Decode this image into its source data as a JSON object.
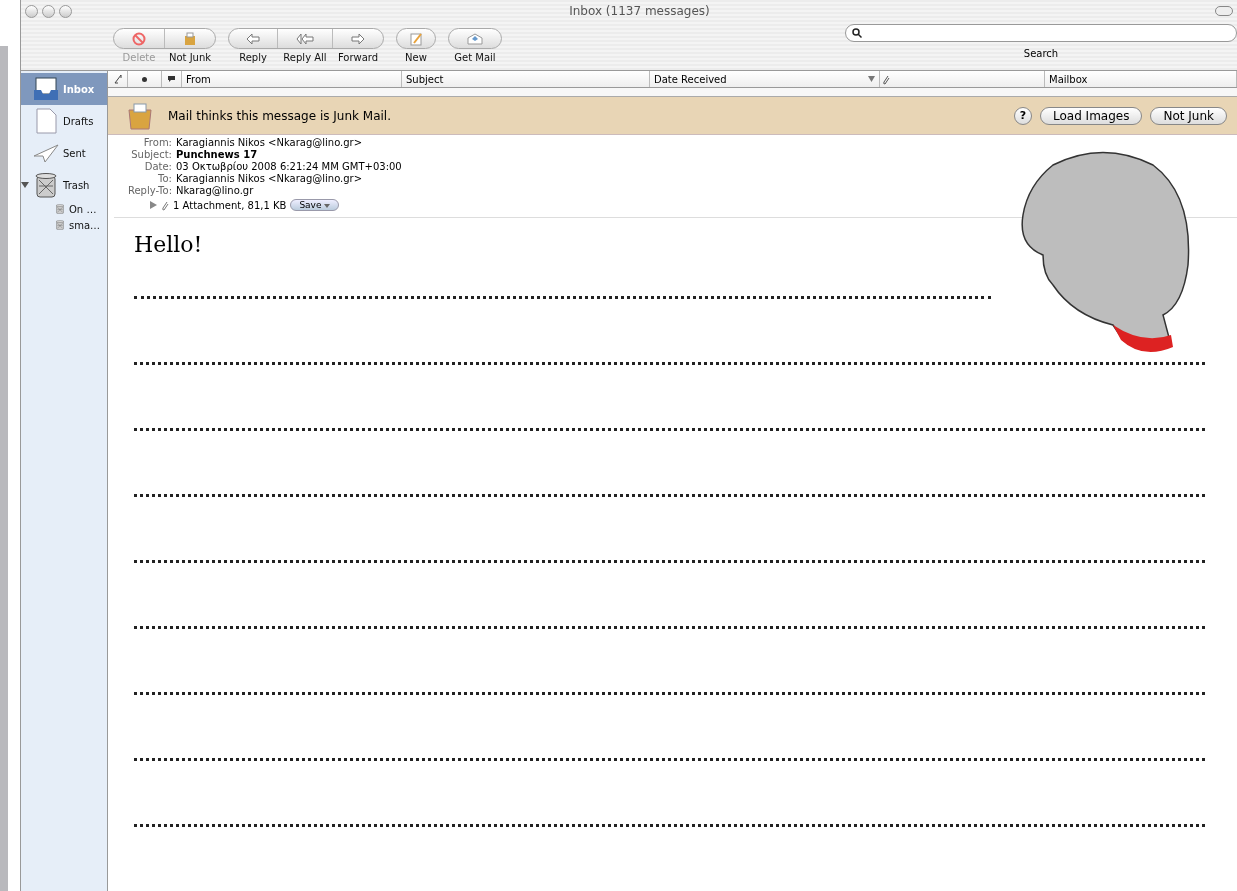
{
  "window": {
    "title": "Inbox (1137 messages)"
  },
  "toolbar": {
    "groups": [
      [
        {
          "label": "Delete",
          "kind": "delete",
          "disabled": true
        },
        {
          "label": "Not Junk",
          "kind": "junk",
          "disabled": false
        }
      ],
      [
        {
          "label": "Reply",
          "kind": "reply",
          "disabled": false
        },
        {
          "label": "Reply All",
          "kind": "replyall",
          "disabled": false
        },
        {
          "label": "Forward",
          "kind": "forward",
          "disabled": false
        }
      ],
      [
        {
          "label": "New",
          "kind": "new",
          "disabled": false
        }
      ],
      [
        {
          "label": "Get Mail",
          "kind": "getmail",
          "disabled": false
        }
      ]
    ],
    "search": {
      "label": "Search"
    }
  },
  "sidebar": {
    "items": [
      {
        "label": "Inbox",
        "kind": "inbox",
        "selected": true
      },
      {
        "label": "Drafts",
        "kind": "drafts",
        "selected": false
      },
      {
        "label": "Sent",
        "kind": "sent",
        "selected": false
      },
      {
        "label": "Trash",
        "kind": "trash",
        "selected": false,
        "expanded": true,
        "children": [
          {
            "label": "On …",
            "kind": "trash",
            "selected": false
          },
          {
            "label": "sma…",
            "kind": "trash",
            "selected": false
          }
        ]
      }
    ]
  },
  "table": {
    "columns": [
      {
        "kind": "thread"
      },
      {
        "kind": "status"
      },
      {
        "kind": "flag"
      },
      {
        "kind": "text",
        "label": "From",
        "sorted": false
      },
      {
        "kind": "text",
        "label": "Subject",
        "sorted": false
      },
      {
        "kind": "text",
        "label": "Date Received",
        "sorted": true
      },
      {
        "kind": "attachment"
      },
      {
        "kind": "text",
        "label": "Mailbox",
        "sorted": false
      }
    ]
  },
  "junk_bar": {
    "message": "Mail thinks this message is Junk Mail.",
    "help": "?",
    "buttons": [
      "Load Images",
      "Not Junk"
    ]
  },
  "headers": [
    {
      "label": "From:",
      "value": "Karagiannis Nikos <Nkarag@lino.gr>",
      "bold": false
    },
    {
      "label": "Subject:",
      "value": "Punchnews 17",
      "bold": true
    },
    {
      "label": "Date:",
      "value": "03 Οκτωβρίου 2008 6:21:24 ΜΜ GMT+03:00",
      "bold": false
    },
    {
      "label": "To:",
      "value": "Karagiannis Nikos <Nkarag@lino.gr>",
      "bold": false
    },
    {
      "label": "Reply-To:",
      "value": "Nkarag@lino.gr",
      "bold": false
    }
  ],
  "attachment": {
    "text": "1 Attachment, 81,1 KB",
    "button": "Save",
    "expanded": false
  },
  "body": {
    "greeting": "Hello!",
    "lines": [
      {
        "kind": "short"
      },
      {
        "kind": "full"
      },
      {
        "kind": "full"
      },
      {
        "kind": "full"
      },
      {
        "kind": "full"
      },
      {
        "kind": "full"
      },
      {
        "kind": "full"
      },
      {
        "kind": "full"
      },
      {
        "kind": "full"
      }
    ]
  }
}
